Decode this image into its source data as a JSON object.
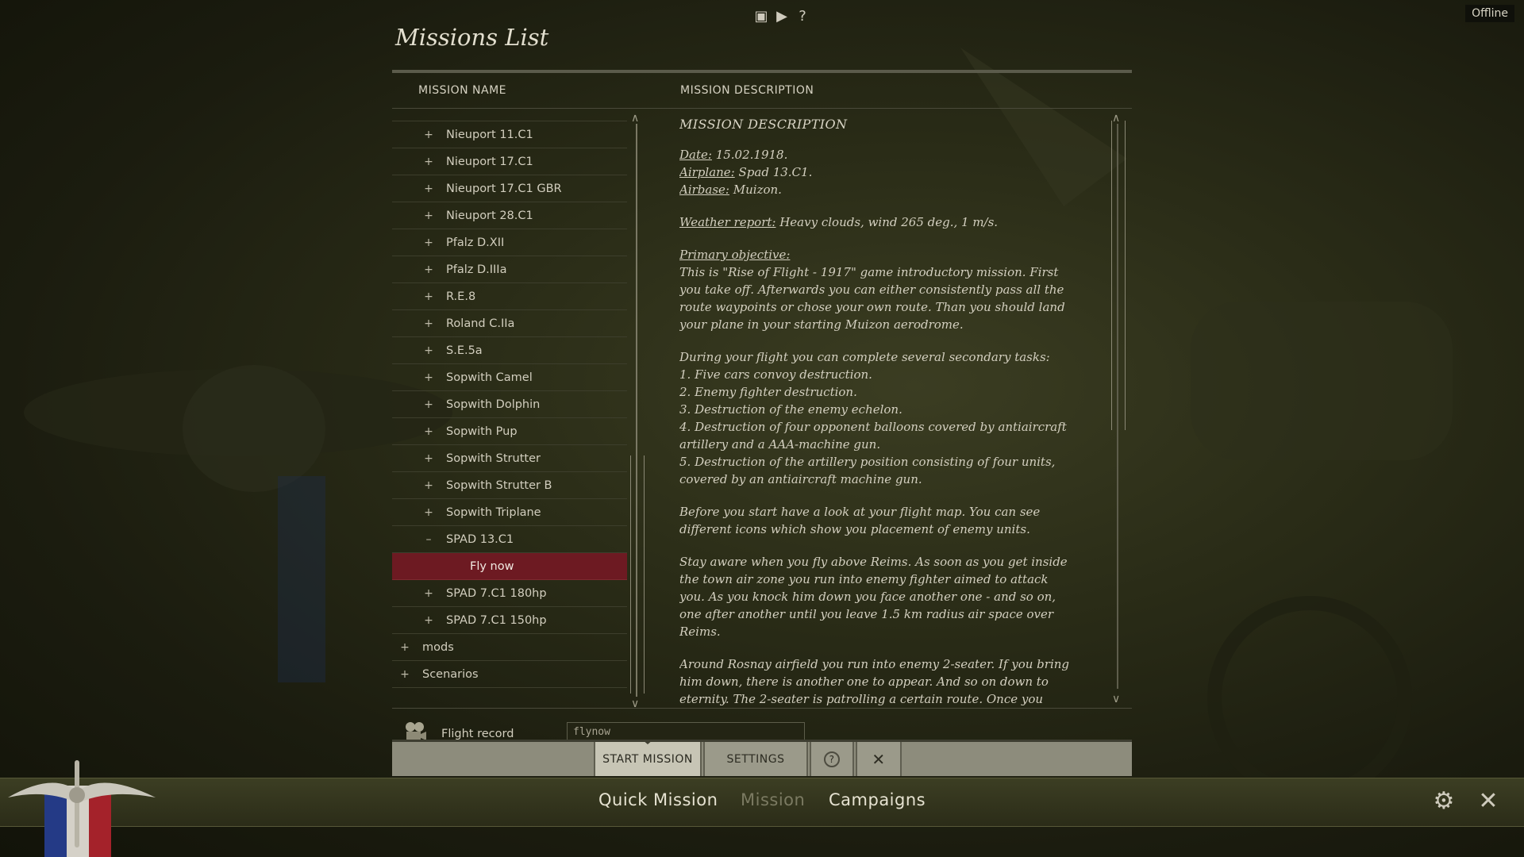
{
  "status": {
    "offline": "Offline"
  },
  "top_icons": [
    "book-icon",
    "film-icon",
    "help-icon"
  ],
  "title": "Missions List",
  "columns": {
    "name": "MISSION NAME",
    "description": "MISSION DESCRIPTION"
  },
  "list": {
    "partial_top": "",
    "rows": [
      {
        "sign": "+",
        "label": "Nieuport 11.C1",
        "level": 1
      },
      {
        "sign": "+",
        "label": "Nieuport 17.C1",
        "level": 1
      },
      {
        "sign": "+",
        "label": "Nieuport 17.C1 GBR",
        "level": 1
      },
      {
        "sign": "+",
        "label": "Nieuport 28.C1",
        "level": 1
      },
      {
        "sign": "+",
        "label": "Pfalz D.XII",
        "level": 1
      },
      {
        "sign": "+",
        "label": "Pfalz D.IIIa",
        "level": 1
      },
      {
        "sign": "+",
        "label": "R.E.8",
        "level": 1
      },
      {
        "sign": "+",
        "label": "Roland C.IIa",
        "level": 1
      },
      {
        "sign": "+",
        "label": "S.E.5a",
        "level": 1
      },
      {
        "sign": "+",
        "label": "Sopwith Camel",
        "level": 1
      },
      {
        "sign": "+",
        "label": "Sopwith Dolphin",
        "level": 1
      },
      {
        "sign": "+",
        "label": "Sopwith Pup",
        "level": 1
      },
      {
        "sign": "+",
        "label": "Sopwith Strutter",
        "level": 1
      },
      {
        "sign": "+",
        "label": "Sopwith Strutter B",
        "level": 1
      },
      {
        "sign": "+",
        "label": "Sopwith Triplane",
        "level": 1
      },
      {
        "sign": "–",
        "label": "SPAD 13.C1",
        "level": 1
      },
      {
        "sign": "",
        "label": "Fly now",
        "level": 2,
        "selected": true
      },
      {
        "sign": "+",
        "label": "SPAD 7.C1 180hp",
        "level": 1
      },
      {
        "sign": "+",
        "label": "SPAD 7.C1 150hp",
        "level": 1
      },
      {
        "sign": "+",
        "label": "mods",
        "level": 0
      },
      {
        "sign": "+",
        "label": "Scenarios",
        "level": 0
      }
    ]
  },
  "description": {
    "heading": "MISSION DESCRIPTION",
    "date_label": "Date:",
    "date": " 15.02.1918.",
    "airplane_label": "Airplane:",
    "airplane": " Spad 13.C1.",
    "airbase_label": "Airbase:",
    "airbase": " Muizon.",
    "weather_label": "Weather report:",
    "weather": " Heavy clouds, wind 265 deg., 1 m/s.",
    "objective_label": "Primary objective:",
    "objective": "This is \"Rise of Flight - 1917\" game introductory mission. First you take off. Afterwards you can either consistently pass all the route waypoints or chose your own route. Than you should land your plane in your starting Muizon aerodrome.",
    "tasks_intro": "During your flight you can complete several secondary tasks:",
    "tasks": [
      "1. Five cars convoy destruction.",
      "2. Enemy fighter destruction.",
      "3. Destruction of the enemy echelon.",
      "4. Destruction of four opponent balloons covered by antiaircraft artillery and a AAA-machine gun.",
      "5. Destruction of the artillery position consisting of four units, covered by an antiaircraft machine gun."
    ],
    "para_map": "Before you start have a look at your flight map. You can see different icons which show you placement of enemy units.",
    "para_reims": "Stay aware when you fly above Reims. As soon as you get inside the town air zone you run into enemy fighter aimed to attack you. As you knock him down you face another one - and so on, one after another until you leave 1.5 km radius air space over Reims.",
    "para_rosnay": "Around Rosnay airfield you run into enemy 2-seater. If you bring him down, there is another one to appear. And so on down to eternity. The 2-seater is patrolling a certain route. Once you come"
  },
  "flight_record": {
    "label": "Flight record",
    "value": "flynow"
  },
  "buttons": {
    "start": "START MISSION",
    "settings": "SETTINGS",
    "help": "?",
    "close": "✕"
  },
  "bottom_nav": {
    "quick": "Quick Mission",
    "mission": "Mission",
    "campaigns": "Campaigns"
  }
}
